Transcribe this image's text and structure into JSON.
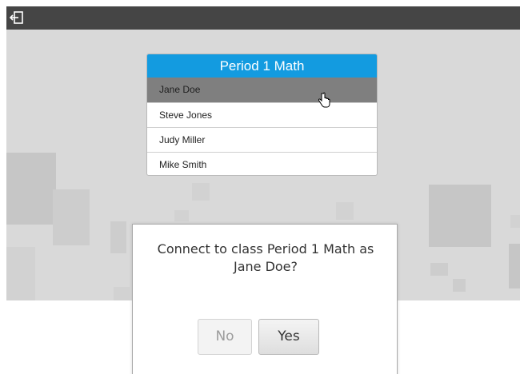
{
  "class_list": {
    "title": "Period 1 Math",
    "students": [
      "Jane Doe",
      "Steve Jones",
      "Judy Miller",
      "Mike Smith"
    ],
    "selected_student": "Jane Doe"
  },
  "dialog": {
    "message": "Connect to class Period 1 Math as Jane Doe?",
    "no_label": "No",
    "yes_label": "Yes"
  },
  "colors": {
    "header_blue": "#139be0",
    "topbar": "#454545",
    "selected_row": "#7f7f7f"
  },
  "icons": {
    "exit": "exit-icon",
    "cursor": "hand-pointer-icon"
  }
}
